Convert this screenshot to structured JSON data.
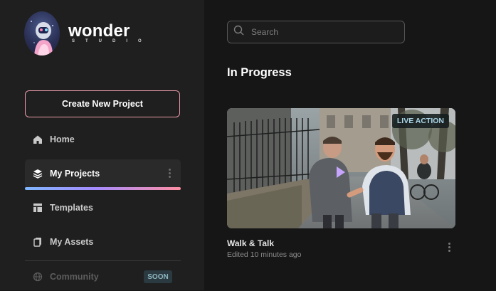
{
  "brand": {
    "name": "wonder",
    "subtitle": "STUDIO"
  },
  "sidebar": {
    "create_button": "Create New Project",
    "items": [
      {
        "label": "Home",
        "icon": "home-icon"
      },
      {
        "label": "My Projects",
        "icon": "layers-icon",
        "active": true
      },
      {
        "label": "Templates",
        "icon": "template-icon"
      },
      {
        "label": "My Assets",
        "icon": "assets-icon"
      },
      {
        "label": "Community",
        "icon": "globe-icon",
        "disabled": true
      }
    ],
    "community_badge": "SOON"
  },
  "search": {
    "placeholder": "Search",
    "value": ""
  },
  "main": {
    "section_title": "In Progress",
    "projects": [
      {
        "badge": "LIVE ACTION",
        "title": "Walk & Talk",
        "meta": "Edited 10 minutes ago"
      }
    ]
  },
  "colors": {
    "accent_border": "#e99aa8",
    "badge_text": "#a9d4e6",
    "active_bar_start": "#7fb6ff",
    "active_bar_end": "#ff8fa3"
  }
}
